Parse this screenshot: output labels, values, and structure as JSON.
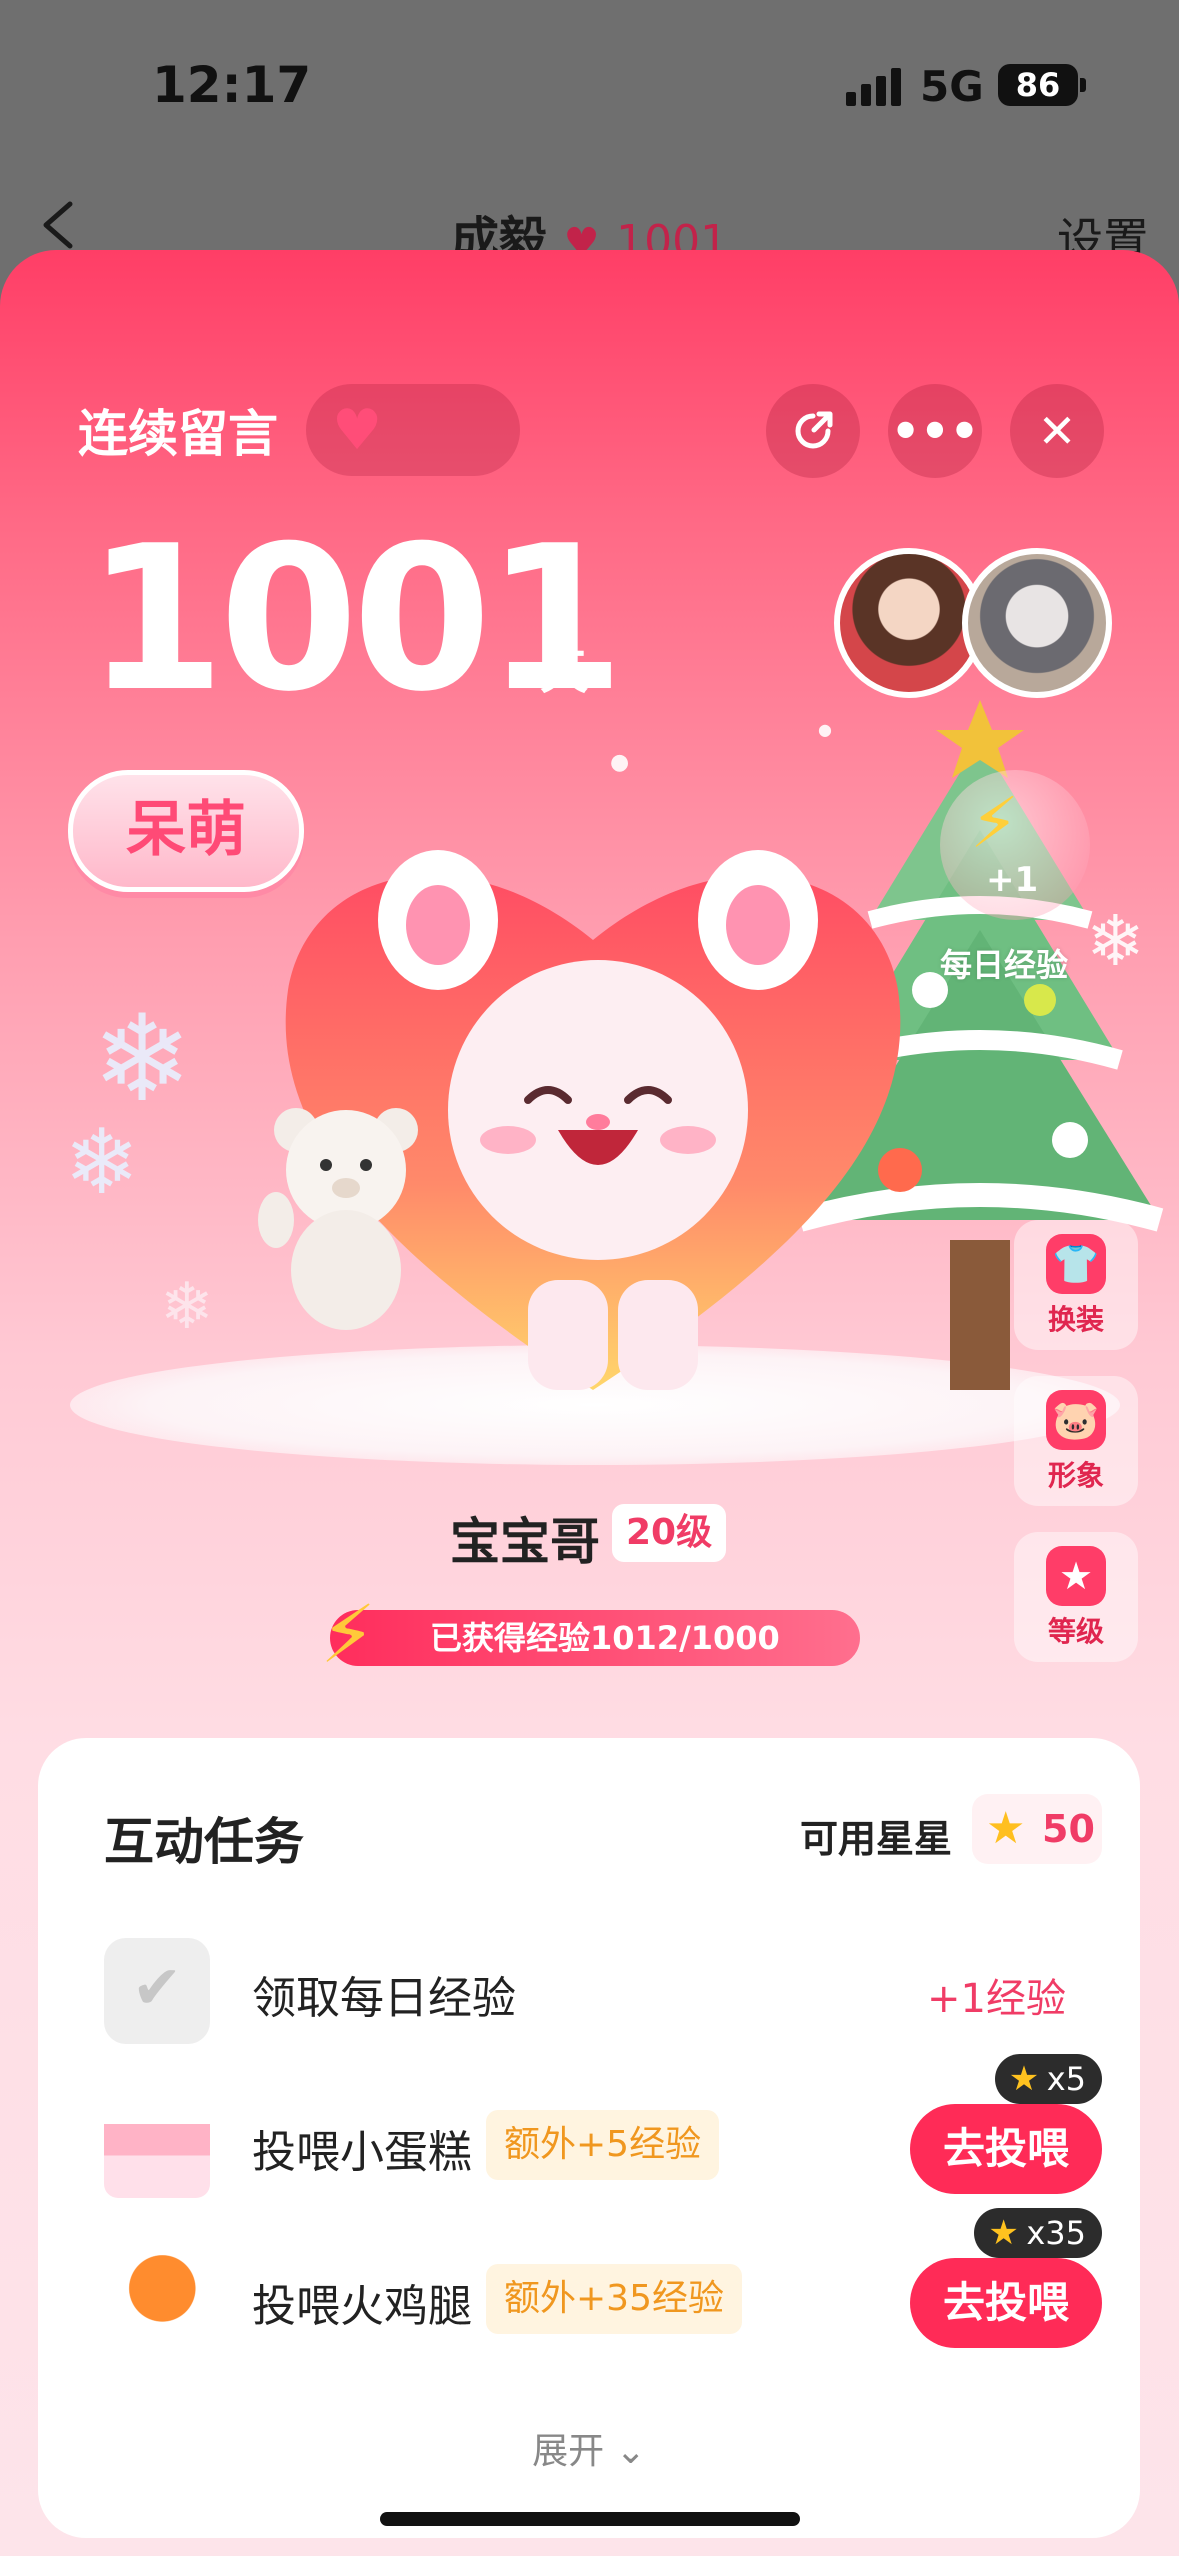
{
  "status_bar": {
    "time": "12:17",
    "network": "5G",
    "battery": "86"
  },
  "nav": {
    "title": "成毅",
    "heart_count": "1001",
    "settings_label": "设置"
  },
  "sheet": {
    "streak_label": "连续留言",
    "days": "1001",
    "days_unit": "天",
    "badge": "呆萌",
    "daily_bonus": {
      "plus": "+1",
      "label": "每日经验"
    },
    "side_buttons": [
      {
        "label": "换装",
        "icon": "shirt-icon"
      },
      {
        "label": "形象",
        "icon": "pig-face-icon"
      },
      {
        "label": "等级",
        "icon": "star-icon"
      }
    ],
    "pet_name": "宝宝哥",
    "pet_level": "20级",
    "exp_text": "已获得经验1012/1000",
    "exp_progress": 1.0
  },
  "tasks_card": {
    "title": "互动任务",
    "stars_label": "可用星星",
    "stars_count": "50",
    "tasks": [
      {
        "name": "领取每日经验",
        "reward": "+1经验",
        "icon": "check-icon"
      },
      {
        "name": "投喂小蛋糕",
        "extra": "额外+5经验",
        "button": "去投喂",
        "cost": "x5",
        "icon": "cake-icon"
      },
      {
        "name": "投喂火鸡腿",
        "extra": "额外+35经验",
        "button": "去投喂",
        "cost": "x35",
        "icon": "drumstick-icon"
      }
    ],
    "expand_label": "展开"
  },
  "colors": {
    "accent": "#ff2b57",
    "reward": "#f03c66",
    "extra": "#f0971f"
  }
}
